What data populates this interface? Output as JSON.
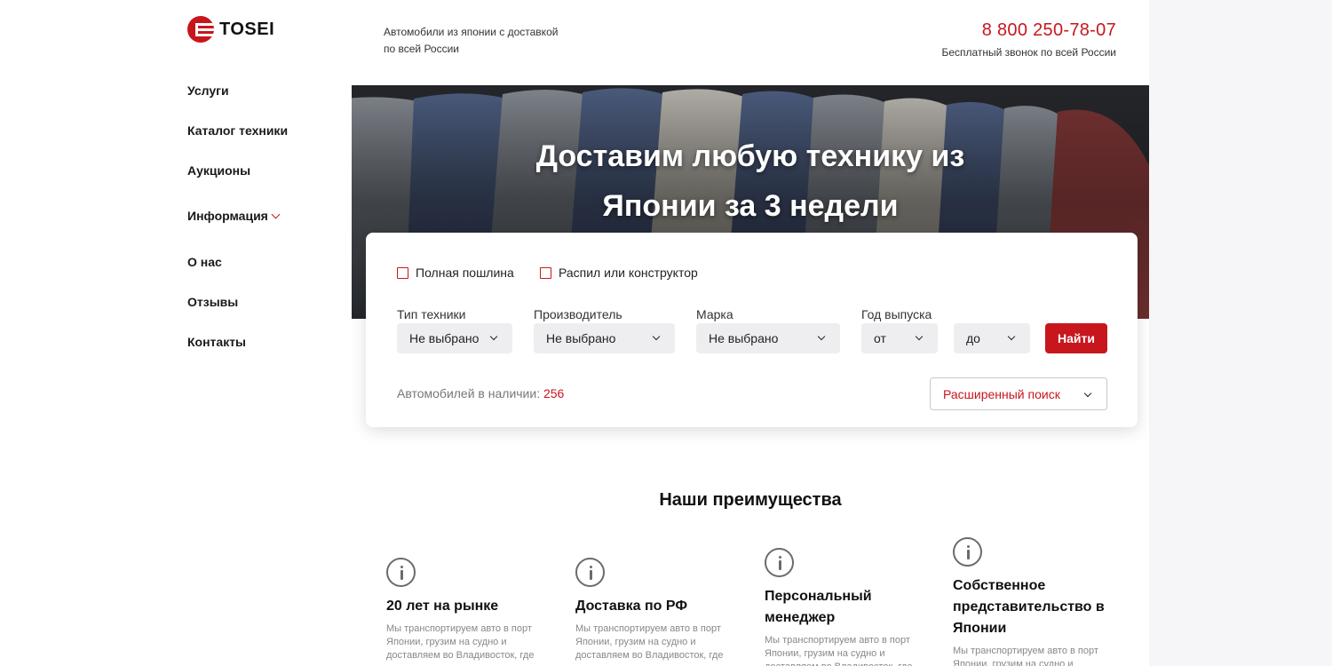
{
  "brand": {
    "name": "TOSEI"
  },
  "nav": {
    "items": [
      {
        "label": "Услуги"
      },
      {
        "label": "Каталог техники"
      },
      {
        "label": "Аукционы"
      },
      {
        "label": "Информация"
      },
      {
        "label": "О нас"
      },
      {
        "label": "Отзывы"
      },
      {
        "label": "Контакты"
      }
    ]
  },
  "header": {
    "tagline": "Автомобили из японии с доставкой по всей России",
    "phone": "8 800 250-78-07",
    "phone_note": "Бесплатный звонок по всей России"
  },
  "hero": {
    "title_line1": "Доставим любую технику из",
    "title_line2": "Японии за 3 недели"
  },
  "search": {
    "checkbox_full_duty": "Полная пошлина",
    "checkbox_parts": "Распил или конструктор",
    "type_label": "Тип техники",
    "type_value": "Не выбрано",
    "maker_label": "Производитель",
    "maker_value": "Не выбрано",
    "brand_label": "Марка",
    "brand_value": "Не выбрано",
    "year_label": "Год выпуска",
    "year_from": "от",
    "year_to": "до",
    "find_button": "Найти",
    "stock_label": "Автомобилей в наличии:",
    "stock_count": "256",
    "advanced_search": "Расширенный поиск"
  },
  "advantages": {
    "title": "Наши преимущества",
    "items": [
      {
        "title": "20 лет на рынке",
        "text": "Мы транспортируем авто в порт Японии, грузим на судно и доставляем во Владивосток, где"
      },
      {
        "title": "Доставка по РФ",
        "text": "Мы транспортируем авто в порт Японии, грузим на судно и доставляем во Владивосток, где"
      },
      {
        "title": "Персональный менеджер",
        "text": "Мы транспортируем авто в порт Японии, грузим на судно и доставляем во Владивосток, где"
      },
      {
        "title": "Собственное представительство в Японии",
        "text": "Мы транспортируем авто в порт Японии, грузим на судно и"
      }
    ]
  },
  "colors": {
    "accent": "#c8161d",
    "page_bg": "#f6f6f8",
    "select_bg": "#eeeef0"
  }
}
